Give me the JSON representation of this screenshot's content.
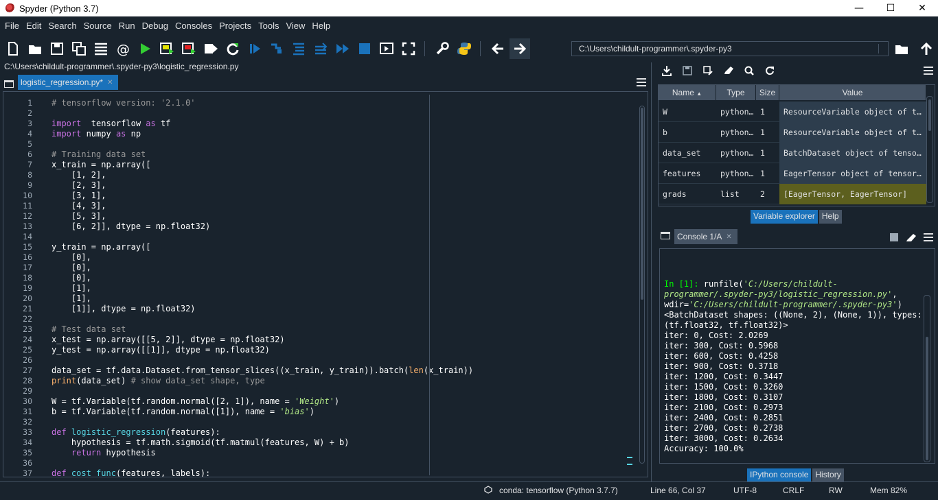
{
  "window": {
    "title": "Spyder (Python 3.7)",
    "min": "—",
    "max": "☐",
    "close": "✕"
  },
  "menu": [
    "File",
    "Edit",
    "Search",
    "Source",
    "Run",
    "Debug",
    "Consoles",
    "Projects",
    "Tools",
    "View",
    "Help"
  ],
  "toolbar": {
    "working_dir": "C:\\Users\\childult-programmer\\.spyder-py3"
  },
  "editor": {
    "file_path": "C:\\Users\\childult-programmer\\.spyder-py3\\logistic_regression.py",
    "tab_label": "logistic_regression.py*",
    "tab_close": "✕",
    "line_numbers": [
      "1",
      "2",
      "3",
      "4",
      "5",
      "6",
      "7",
      "8",
      "9",
      "10",
      "11",
      "12",
      "13",
      "14",
      "15",
      "16",
      "17",
      "18",
      "19",
      "20",
      "21",
      "22",
      "23",
      "24",
      "25",
      "26",
      "27",
      "28",
      "29",
      "30",
      "31",
      "32",
      "33",
      "34",
      "35",
      "36",
      "37"
    ]
  },
  "variable_explorer": {
    "headers": [
      "Name",
      "Type",
      "Size",
      "Value"
    ],
    "rows": [
      {
        "name": "W",
        "type": "python…",
        "size": "1",
        "value": "ResourceVariable object of t…"
      },
      {
        "name": "b",
        "type": "python…",
        "size": "1",
        "value": "ResourceVariable object of t…"
      },
      {
        "name": "data_set",
        "type": "python…",
        "size": "1",
        "value": "BatchDataset object of tenso…"
      },
      {
        "name": "features",
        "type": "python…",
        "size": "1",
        "value": "EagerTensor object of tensor…"
      },
      {
        "name": "grads",
        "type": "list",
        "size": "2",
        "value": "[EagerTensor, EagerTensor]"
      }
    ],
    "row_colors": [
      "#2d3d4d",
      "#2d3d4d",
      "#2d3d4d",
      "#2d3d4d",
      "#5c5f1e"
    ],
    "tabs": [
      "Variable explorer",
      "Help"
    ]
  },
  "console": {
    "tab_label": "Console 1/A",
    "tab_close": "✕",
    "prompt": "In [1]:",
    "run_cmd": " runfile(",
    "run_path": "'C:/Users/childult-",
    "run_path2": "programmer/.spyder-py3/logistic_regression.py'",
    "run_sep": ",",
    "wdir_label": "wdir=",
    "wdir_path": "'C:/Users/childult-programmer/.spyder-py3'",
    "wdir_close": ")",
    "output": [
      "<BatchDataset shapes: ((None, 2), (None, 1)), types:",
      "(tf.float32, tf.float32)>",
      "iter: 0, Cost: 2.0269",
      "iter: 300, Cost: 0.5968",
      "iter: 600, Cost: 0.4258",
      "iter: 900, Cost: 0.3718",
      "iter: 1200, Cost: 0.3447",
      "iter: 1500, Cost: 0.3260",
      "iter: 1800, Cost: 0.3107",
      "iter: 2100, Cost: 0.2973",
      "iter: 2400, Cost: 0.2851",
      "iter: 2700, Cost: 0.2738",
      "iter: 3000, Cost: 0.2634",
      "Accuracy: 100.0%"
    ],
    "tabs": [
      "IPython console",
      "History"
    ]
  },
  "statusbar": {
    "env": "conda: tensorflow (Python 3.7.7)",
    "position": "Line 66, Col 37",
    "encoding": "UTF-8",
    "eol": "CRLF",
    "rw": "RW",
    "mem": "Mem 82%"
  },
  "code_lines": [
    {
      "t": [
        [
          "cm",
          "# tensorflow version: '2.1.0'"
        ]
      ]
    },
    {
      "t": []
    },
    {
      "t": [
        [
          "kw",
          "import"
        ],
        [
          "",
          "  tensorflow "
        ],
        [
          "kw",
          "as"
        ],
        [
          "",
          " tf"
        ]
      ]
    },
    {
      "t": [
        [
          "kw",
          "import"
        ],
        [
          "",
          " numpy "
        ],
        [
          "kw",
          "as"
        ],
        [
          "",
          " np"
        ]
      ]
    },
    {
      "t": []
    },
    {
      "t": [
        [
          "cm",
          "# Training data set"
        ]
      ]
    },
    {
      "t": [
        [
          "",
          "x_train = np.array(["
        ]
      ]
    },
    {
      "t": [
        [
          "",
          "    [1, 2],"
        ]
      ]
    },
    {
      "t": [
        [
          "",
          "    [2, 3],"
        ]
      ]
    },
    {
      "t": [
        [
          "",
          "    [3, 1],"
        ]
      ]
    },
    {
      "t": [
        [
          "",
          "    [4, 3],"
        ]
      ]
    },
    {
      "t": [
        [
          "",
          "    [5, 3],"
        ]
      ]
    },
    {
      "t": [
        [
          "",
          "    [6, 2]], dtype = np.float32)"
        ]
      ]
    },
    {
      "t": []
    },
    {
      "t": [
        [
          "",
          "y_train = np.array(["
        ]
      ]
    },
    {
      "t": [
        [
          "",
          "    [0],"
        ]
      ]
    },
    {
      "t": [
        [
          "",
          "    [0],"
        ]
      ]
    },
    {
      "t": [
        [
          "",
          "    [0],"
        ]
      ]
    },
    {
      "t": [
        [
          "",
          "    [1],"
        ]
      ]
    },
    {
      "t": [
        [
          "",
          "    [1],"
        ]
      ]
    },
    {
      "t": [
        [
          "",
          "    [1]], dtype = np.float32)"
        ]
      ]
    },
    {
      "t": []
    },
    {
      "t": [
        [
          "cm",
          "# Test data set"
        ]
      ]
    },
    {
      "t": [
        [
          "",
          "x_test = np.array([[5, 2]], dtype = np.float32)"
        ]
      ]
    },
    {
      "t": [
        [
          "",
          "y_test = np.array([[1]], dtype = np.float32)"
        ]
      ]
    },
    {
      "t": []
    },
    {
      "t": [
        [
          "",
          "data_set = tf.data.Dataset.from_tensor_slices((x_train, y_train)).batch("
        ],
        [
          "bi",
          "len"
        ],
        [
          "",
          "(x_train))"
        ]
      ]
    },
    {
      "t": [
        [
          "bi",
          "print"
        ],
        [
          "",
          "(data_set) "
        ],
        [
          "cm",
          "# show data_set shape, type"
        ]
      ]
    },
    {
      "t": []
    },
    {
      "t": [
        [
          "",
          "W = tf.Variable(tf.random.normal([2, 1]), name = "
        ],
        [
          "st",
          "'Weight'"
        ],
        [
          "",
          ")"
        ]
      ]
    },
    {
      "t": [
        [
          "",
          "b = tf.Variable(tf.random.normal([1]), name = "
        ],
        [
          "st",
          "'bias'"
        ],
        [
          "",
          ")"
        ]
      ]
    },
    {
      "t": []
    },
    {
      "t": [
        [
          "kw",
          "def"
        ],
        [
          "",
          " "
        ],
        [
          "df",
          "logistic_regression"
        ],
        [
          "",
          "(features):"
        ]
      ]
    },
    {
      "t": [
        [
          "",
          "    hypothesis = tf.math.sigmoid(tf.matmul(features, W) + b)"
        ]
      ]
    },
    {
      "t": [
        [
          "",
          "    "
        ],
        [
          "kw",
          "return"
        ],
        [
          "",
          " hypothesis"
        ]
      ]
    },
    {
      "t": []
    },
    {
      "t": [
        [
          "kw",
          "def"
        ],
        [
          "",
          " "
        ],
        [
          "df",
          "cost_func"
        ],
        [
          "",
          "(features, labels):"
        ]
      ]
    }
  ]
}
